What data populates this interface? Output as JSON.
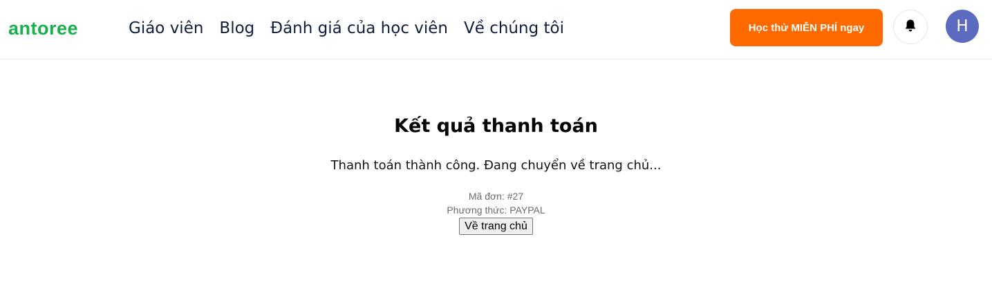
{
  "header": {
    "logo": "antoree",
    "nav": [
      {
        "label": "Giáo viên"
      },
      {
        "label": "Blog"
      },
      {
        "label": "Đánh giá của học viên"
      },
      {
        "label": "Về chúng tôi"
      }
    ],
    "cta_label": "Học thử MIỄN PHÍ ngay",
    "bell_icon": "bell-icon",
    "avatar_initial": "H"
  },
  "colors": {
    "brand": "#18b04a",
    "cta": "#ff6a00",
    "avatar": "#5c6bc0",
    "nav_text": "#0f1f3d"
  },
  "main": {
    "title": "Kết quả thanh toán",
    "message": "Thanh toán thành công. Đang chuyển về trang chủ...",
    "order_line": "Mã đơn: #27",
    "method_line": "Phương thức: PAYPAL",
    "home_button": "Về trang chủ"
  }
}
